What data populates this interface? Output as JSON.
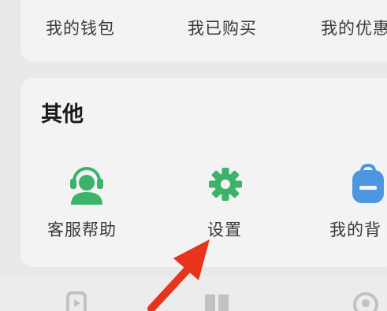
{
  "top_row": {
    "wallet_label": "我的钱包",
    "purchased_label": "我已购买",
    "coupons_label": "我的优惠"
  },
  "other_section": {
    "title": "其他",
    "items": [
      {
        "label": "客服帮助",
        "icon": "headset-support-icon"
      },
      {
        "label": "设置",
        "icon": "gear-icon"
      },
      {
        "label": "我的背",
        "icon": "backpack-icon"
      }
    ]
  },
  "colors": {
    "accent_green": "#3bb36a",
    "backpack_blue": "#4f96e0",
    "arrow_red": "#e8341c",
    "card_bg": "#f3f3f3",
    "page_bg": "#e9e9e9"
  },
  "bottom_tabs": [
    {
      "icon": "play-icon"
    },
    {
      "icon": "book-icon"
    },
    {
      "icon": "profile-icon"
    }
  ]
}
